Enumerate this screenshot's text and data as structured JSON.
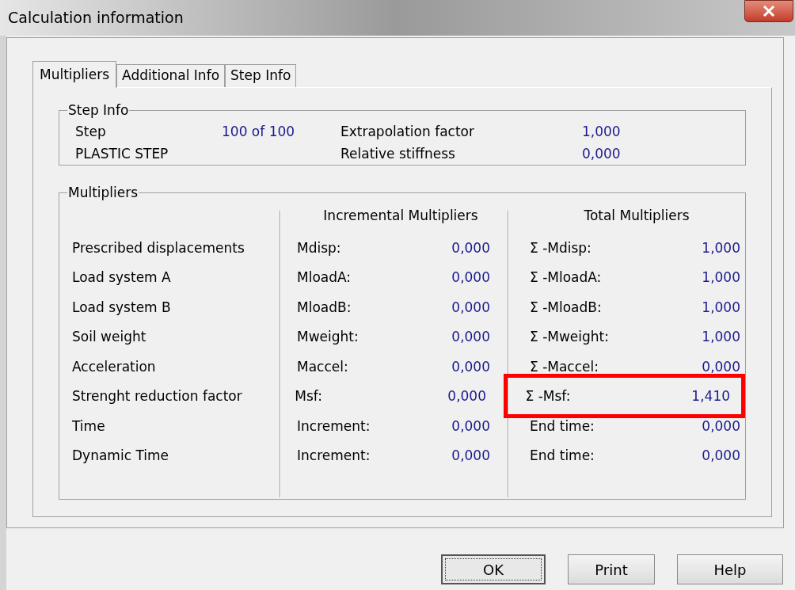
{
  "window": {
    "title": "Calculation information"
  },
  "tabs": [
    {
      "label": "Multipliers",
      "selected": true
    },
    {
      "label": "Additional Info",
      "selected": false
    },
    {
      "label": "Step Info",
      "selected": false
    }
  ],
  "step_info": {
    "title": "Step Info",
    "fields": [
      {
        "label": "Step",
        "value": "100 of 100"
      },
      {
        "label": "Extrapolation factor",
        "value": "1,000"
      },
      {
        "label": "PLASTIC STEP"
      },
      {
        "label": "Relative stiffness",
        "value": "0,000"
      }
    ]
  },
  "multipliers": {
    "title": "Multipliers",
    "incremental_header": "Incremental Multipliers",
    "total_header": "Total Multipliers",
    "rows": [
      {
        "label": "Prescribed displacements",
        "inc_label": "Mdisp:",
        "inc_value": "0,000",
        "total_label": "Σ -Mdisp:",
        "total_value": "1,000",
        "highlighted": false
      },
      {
        "label": "Load system A",
        "inc_label": "MloadA:",
        "inc_value": "0,000",
        "total_label": "Σ -MloadA:",
        "total_value": "1,000",
        "highlighted": false
      },
      {
        "label": "Load system B",
        "inc_label": "MloadB:",
        "inc_value": "0,000",
        "total_label": "Σ -MloadB:",
        "total_value": "1,000",
        "highlighted": false
      },
      {
        "label": "Soil weight",
        "inc_label": "Mweight:",
        "inc_value": "0,000",
        "total_label": "Σ -Mweight:",
        "total_value": "1,000",
        "highlighted": false
      },
      {
        "label": "Acceleration",
        "inc_label": "Maccel:",
        "inc_value": "0,000",
        "total_label": "Σ -Maccel:",
        "total_value": "0,000",
        "highlighted": false
      },
      {
        "label": "Strenght reduction factor",
        "inc_label": "Msf:",
        "inc_value": "0,000",
        "total_label": "Σ -Msf:",
        "total_value": "1,410",
        "highlighted": true
      },
      {
        "label": "Time",
        "inc_label": "Increment:",
        "inc_value": "0,000",
        "total_label": "End time:",
        "total_value": "0,000",
        "highlighted": false
      },
      {
        "label": "Dynamic Time",
        "inc_label": "Increment:",
        "inc_value": "0,000",
        "total_label": "End time:",
        "total_value": "0,000",
        "highlighted": false
      }
    ]
  },
  "buttons": [
    {
      "label": "OK",
      "default": true
    },
    {
      "label": "Print",
      "default": false
    },
    {
      "label": "Help",
      "default": false
    }
  ]
}
